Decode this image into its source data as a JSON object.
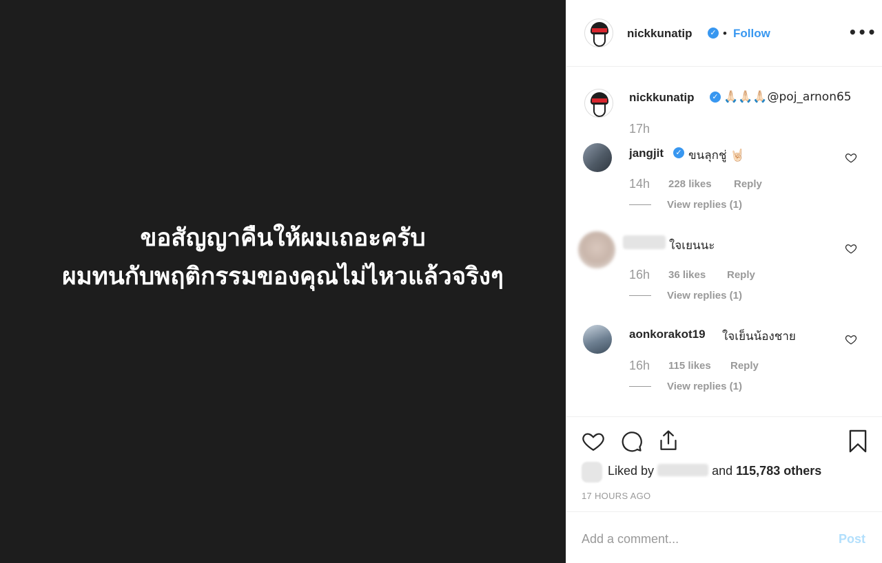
{
  "post_image": {
    "lines": [
      "ขอสัญญาคืนให้ผมเถอะครับ",
      "ผมทนกับพฤติกรรมของคุณไม่ไหวแล้วจริงๆ"
    ],
    "background": "#1d1d1d"
  },
  "header": {
    "username": "nickkunatip",
    "follow_label": "Follow",
    "separator": "•",
    "more_label": "•••"
  },
  "caption": {
    "username": "nickkunatip",
    "text": "🙏🏻🙏🏻🙏🏻@poj_arnon65",
    "time": "17h"
  },
  "comments": [
    {
      "username": "jangjit",
      "verified": true,
      "text": "ขนลุกชู่ 🤘🏻",
      "time": "14h",
      "likes": "228 likes",
      "reply": "Reply",
      "view_replies": "View replies (1)"
    },
    {
      "username": "",
      "verified": false,
      "text": "ใจเยนนะ",
      "time": "16h",
      "likes": "36 likes",
      "reply": "Reply",
      "view_replies": "View replies (1)"
    },
    {
      "username": "aonkorakot19",
      "verified": false,
      "text": "ใจเย็นน้องชาย",
      "time": "16h",
      "likes": "115 likes",
      "reply": "Reply",
      "view_replies": "View replies (1)"
    }
  ],
  "likes_summary": {
    "prefix": "Liked by",
    "middle": "and",
    "others": "115,783 others"
  },
  "posted_ago": "17 HOURS AGO",
  "comment_box": {
    "placeholder": "Add a comment...",
    "post_label": "Post"
  },
  "colors": {
    "accent": "#3897f0",
    "post_disabled": "#b2dffc",
    "muted": "#999999",
    "text": "#262626"
  },
  "icons": [
    "verified-badge-icon",
    "more-options-icon",
    "heart-icon",
    "comment-icon",
    "share-icon",
    "bookmark-icon"
  ]
}
